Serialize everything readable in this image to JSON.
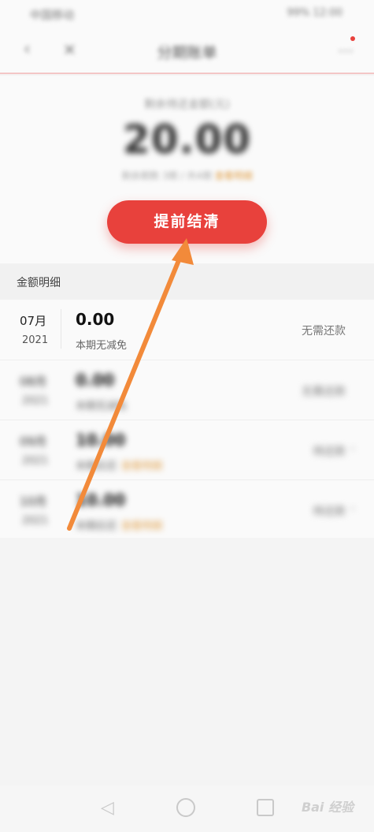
{
  "status_bar": {
    "left": "中国移动",
    "right": "99% 12:00"
  },
  "nav": {
    "back_icon": "back-arrow-icon",
    "close_icon": "close-icon",
    "title": "分期账单",
    "more_icon": "more-icon"
  },
  "summary": {
    "label": "剩余待还金额(元)",
    "amount": "20.00",
    "note": "剩余期数 3期 / 共4期",
    "note_accent": "查看明细"
  },
  "payoff_button": {
    "label": "提前结清"
  },
  "section": {
    "title": "金额明细"
  },
  "rows": [
    {
      "month": "07月",
      "year": "2021",
      "amount": "0.00",
      "desc": "本期无减免",
      "tag": "",
      "status": "无需还款"
    },
    {
      "month": "08月",
      "year": "2021",
      "amount": "0.00",
      "desc": "本期无减免",
      "tag": "",
      "status": "无需还款"
    },
    {
      "month": "09月",
      "year": "2021",
      "amount": "10.00",
      "desc": "本期应还",
      "tag": "查看明细",
      "status": "待还款"
    },
    {
      "month": "10月",
      "year": "2021",
      "amount": "10.00",
      "desc": "本期应还",
      "tag": "查看明细",
      "status": "待还款"
    }
  ],
  "watermark": "Bai 经验",
  "colors": {
    "accent": "#e8413c",
    "arrow": "#f28a3a",
    "tag": "#e0a04a"
  }
}
